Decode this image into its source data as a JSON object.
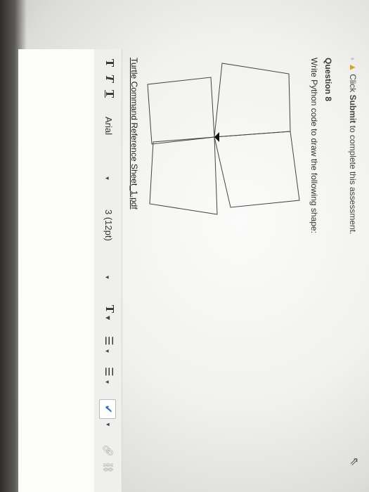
{
  "notice": {
    "prefix": "Click",
    "action": "Submit",
    "suffix": "to complete this assessment."
  },
  "question": {
    "title": "Question 8",
    "prompt": "Write Python code to draw the following shape:"
  },
  "reference_link": "Turtle Command Reference Sheet_1.pdf",
  "toolbar": {
    "bold": "T",
    "italic": "T",
    "underline": "T",
    "font_family": "Arial",
    "font_size": "3 (12pt)",
    "text_color": "T",
    "list_bullets": "☰",
    "list_numbered": "☰"
  },
  "icons": {
    "warning": "warning-icon",
    "cursor": "cursor-icon",
    "spellcheck": "spellcheck-icon",
    "link": "link-icon",
    "unlink": "unlink-icon"
  }
}
